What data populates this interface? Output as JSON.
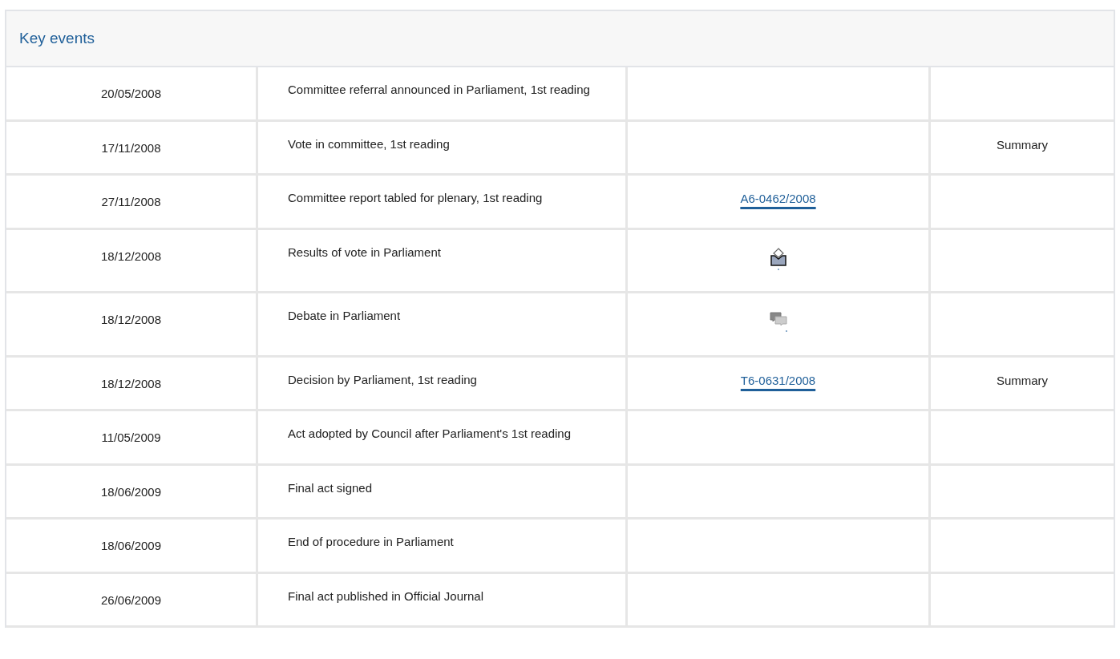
{
  "panel": {
    "title": "Key events"
  },
  "rows": [
    {
      "date": "20/05/2008",
      "event": "Committee referral announced in Parliament, 1st reading",
      "reference": {
        "kind": "none"
      },
      "summary": ""
    },
    {
      "date": "17/11/2008",
      "event": "Vote in committee, 1st reading",
      "reference": {
        "kind": "none"
      },
      "summary": "Summary"
    },
    {
      "date": "27/11/2008",
      "event": "Committee report tabled for plenary, 1st reading",
      "reference": {
        "kind": "link",
        "text": "A6-0462/2008"
      },
      "summary": ""
    },
    {
      "date": "18/12/2008",
      "event": "Results of vote in Parliament",
      "reference": {
        "kind": "vote"
      },
      "summary": ""
    },
    {
      "date": "18/12/2008",
      "event": "Debate in Parliament",
      "reference": {
        "kind": "debate"
      },
      "summary": ""
    },
    {
      "date": "18/12/2008",
      "event": "Decision by Parliament, 1st reading",
      "reference": {
        "kind": "link",
        "text": "T6-0631/2008"
      },
      "summary": "Summary"
    },
    {
      "date": "11/05/2009",
      "event": "Act adopted by Council after Parliament's 1st reading",
      "reference": {
        "kind": "none"
      },
      "summary": ""
    },
    {
      "date": "18/06/2009",
      "event": "Final act signed",
      "reference": {
        "kind": "none"
      },
      "summary": ""
    },
    {
      "date": "18/06/2009",
      "event": "End of procedure in Parliament",
      "reference": {
        "kind": "none"
      },
      "summary": ""
    },
    {
      "date": "26/06/2009",
      "event": "Final act published in Official Journal",
      "reference": {
        "kind": "none"
      },
      "summary": ""
    }
  ]
}
